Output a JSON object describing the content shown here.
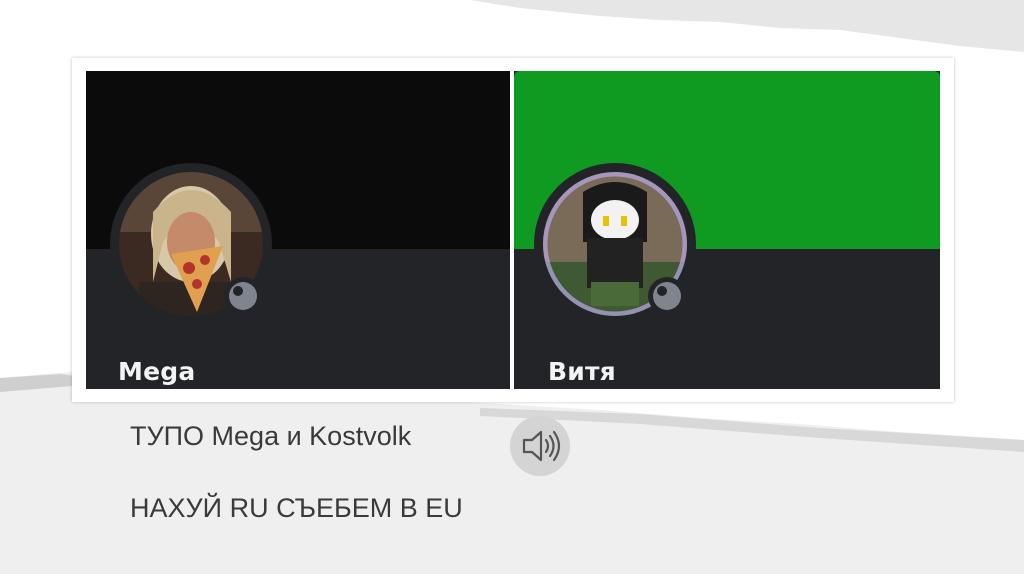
{
  "slide": {
    "cards": [
      {
        "username": "Mega",
        "banner_color": "#0b0b0b",
        "status": "offline"
      },
      {
        "username": "Витя",
        "banner_color": "#0f9a22",
        "status": "offline"
      }
    ],
    "captions": [
      "ТУПО Mega и Kostvolk",
      "НАХУЙ RU СЪЕБЕМ В EU"
    ],
    "audio_icon": "speaker-icon"
  }
}
